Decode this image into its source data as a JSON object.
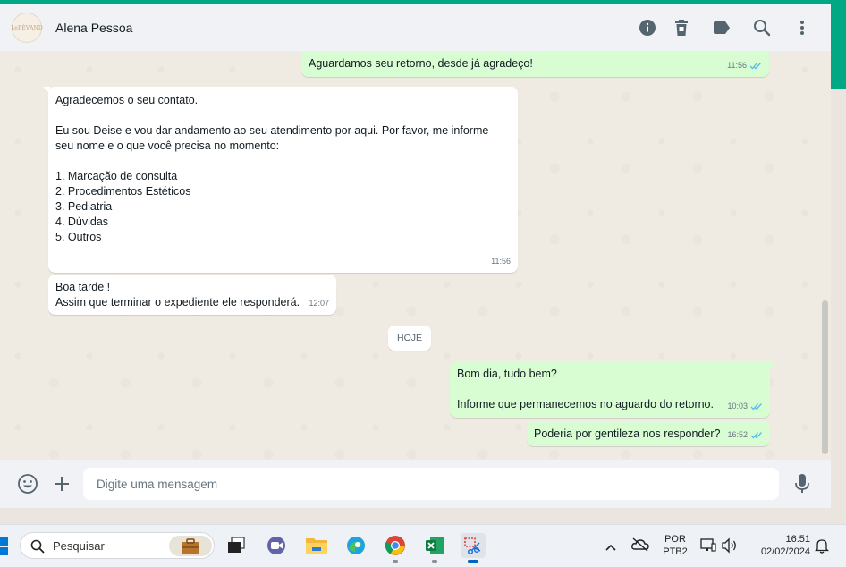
{
  "header": {
    "contact_name": "Alena Pessoa",
    "avatar_text": "LePÉVAND"
  },
  "messages": [
    {
      "id": "m1",
      "direction": "out",
      "text": "Aguardamos seu retorno, desde já agradeço!",
      "time": "11:56",
      "status": "read"
    },
    {
      "id": "m2",
      "direction": "in",
      "text": "Agradecemos o seu contato.\n\nEu sou Deise e vou dar andamento ao seu atendimento por aqui. Por favor, me informe seu nome e o que você precisa no momento:\n\n   1. Marcação de consulta\n   2. Procedimentos Estéticos\n   3. Pediatria\n   4. Dúvidas\n   5. Outros",
      "time": "11:56"
    },
    {
      "id": "m3",
      "direction": "in",
      "text": "Boa tarde !\nAssim que terminar o expediente ele responderá.",
      "time": "12:07"
    },
    {
      "id": "m4",
      "direction": "out",
      "text": "Bom dia, tudo bem?\n\nInforme que permanecemos no aguardo do retorno.",
      "time": "10:03",
      "status": "read"
    },
    {
      "id": "m5",
      "direction": "out",
      "text": "Poderia por gentileza nos responder?",
      "time": "16:52",
      "status": "read"
    }
  ],
  "date_chip": "HOJE",
  "composer": {
    "placeholder": "Digite uma mensagem"
  },
  "taskbar": {
    "search_label": "Pesquisar",
    "language_top": "POR",
    "language_bottom": "PTB2",
    "time": "16:51",
    "date": "02/02/2024"
  },
  "colors": {
    "accent": "#00a884",
    "outgoing_bubble": "#d9fdd3",
    "incoming_bubble": "#ffffff",
    "read_tick": "#53bdeb"
  }
}
